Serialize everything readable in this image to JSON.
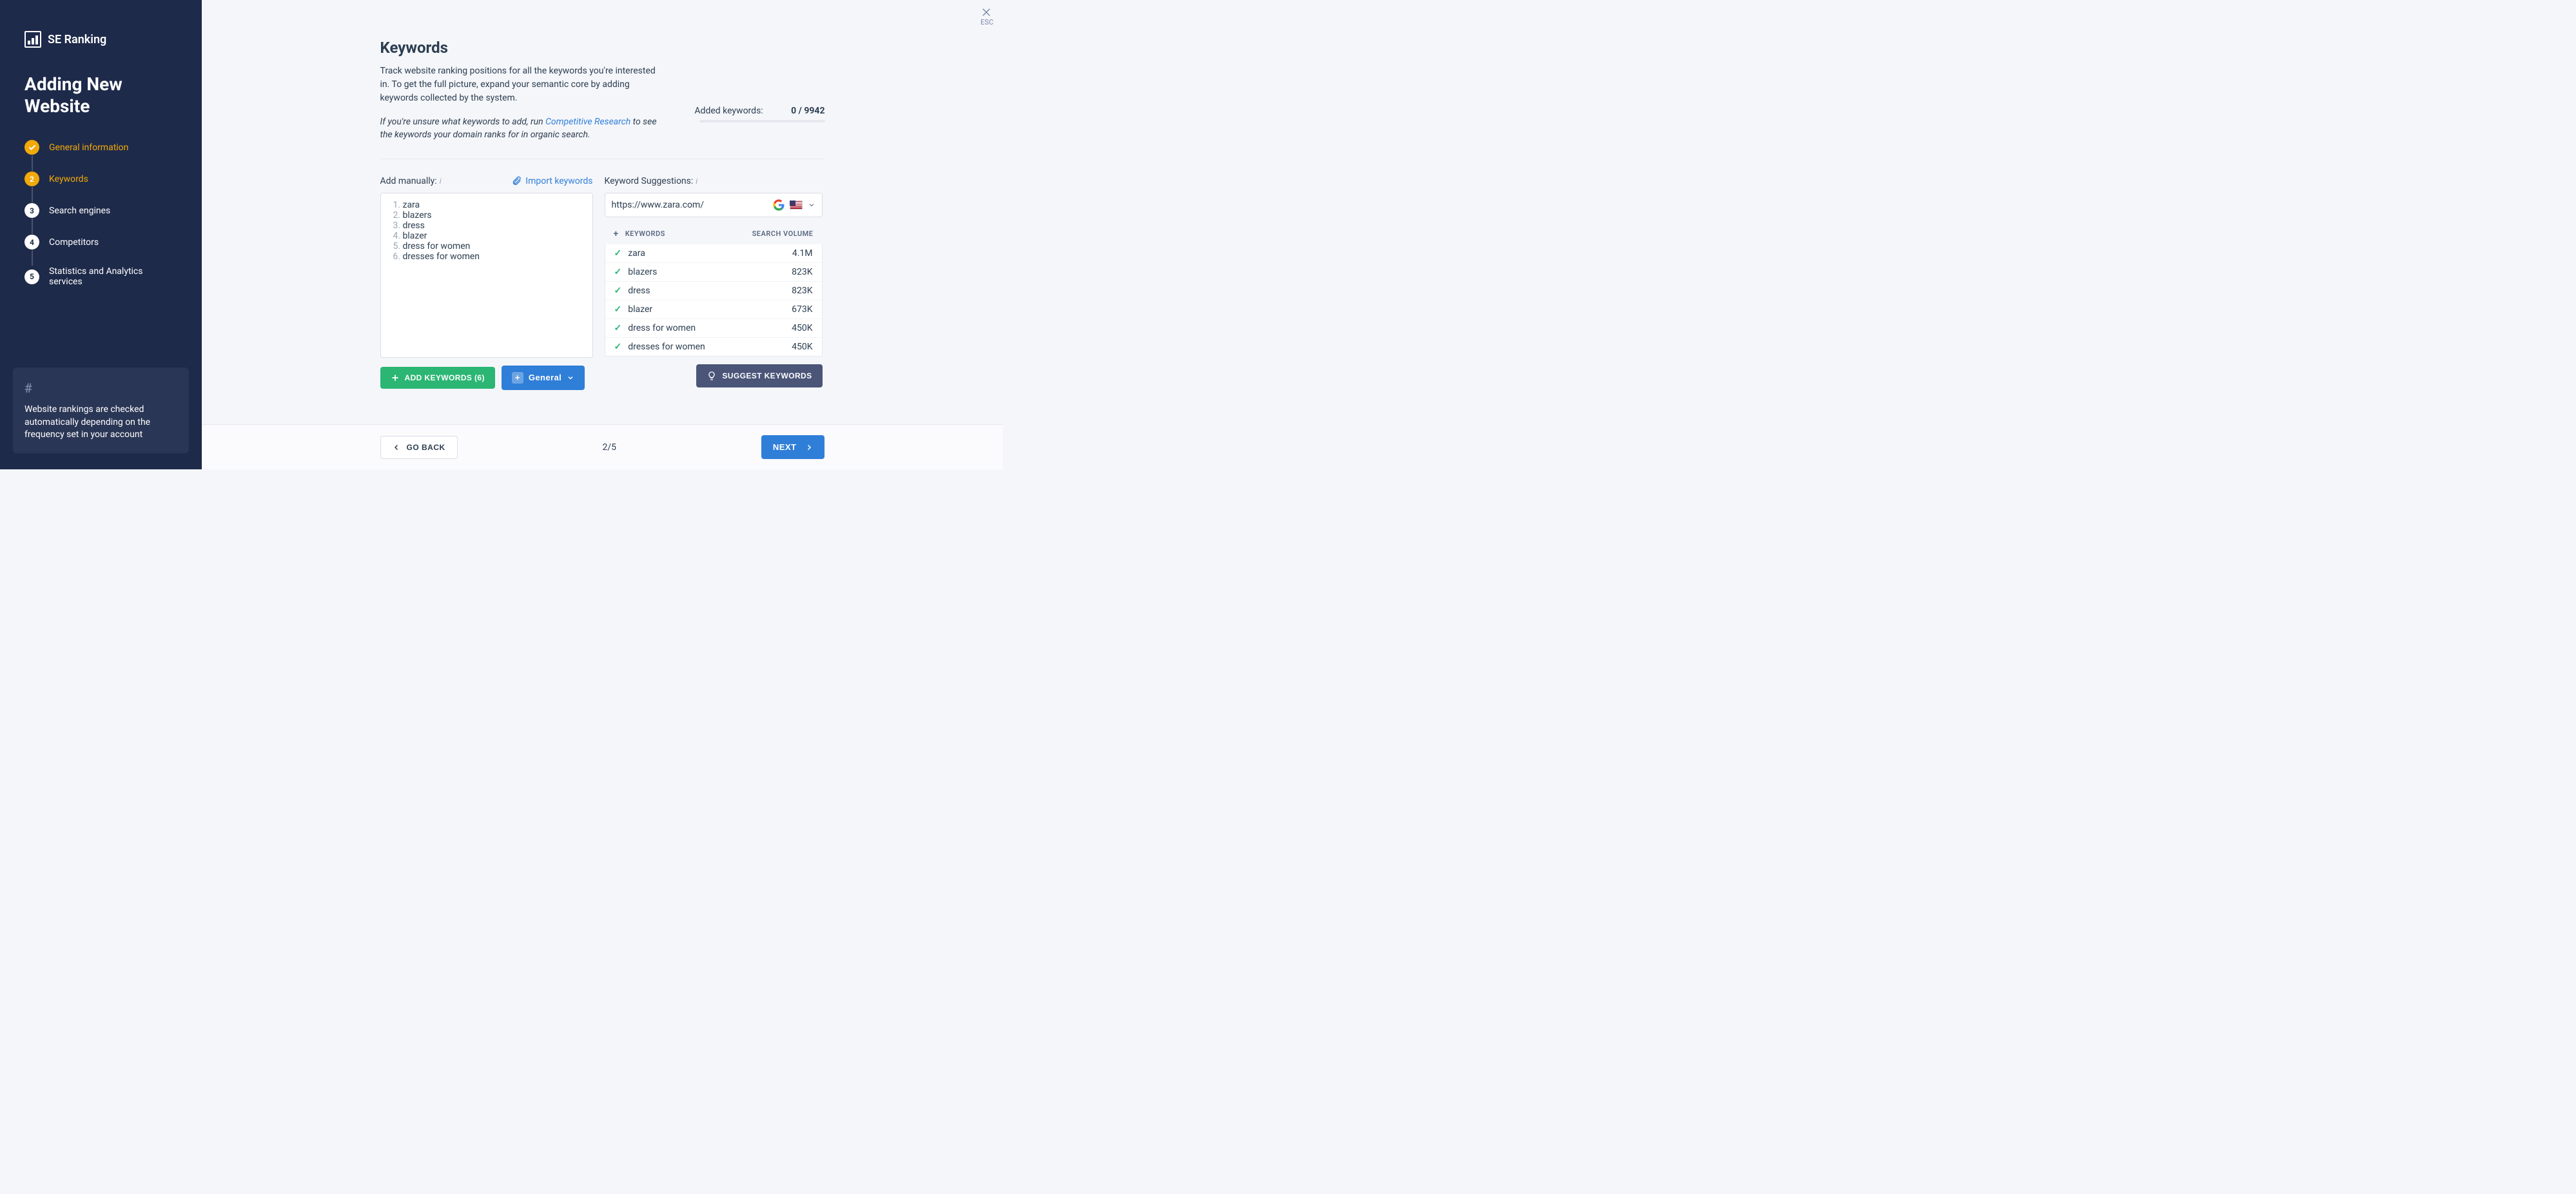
{
  "brand": "SE Ranking",
  "sidebar_title": "Adding New Website",
  "close_label": "ESC",
  "steps": [
    {
      "num_display": "✓",
      "label": "General information"
    },
    {
      "num_display": "2",
      "label": "Keywords"
    },
    {
      "num_display": "3",
      "label": "Search engines"
    },
    {
      "num_display": "4",
      "label": "Competitors"
    },
    {
      "num_display": "5",
      "label": "Statistics and Analytics services"
    }
  ],
  "info_box": "Website rankings are checked automatically depending on the frequency set in your account",
  "page_title": "Keywords",
  "description": "Track website ranking positions for all the keywords you're interested in. To get the full picture, expand your semantic core by adding keywords collected by the system.",
  "hint_pre": "If you're unsure what keywords to add, run ",
  "hint_link": "Competitive Research",
  "hint_post": " to see the keywords your domain ranks for in organic search.",
  "added": {
    "label": "Added keywords:",
    "count": "0 / 9942"
  },
  "manual": {
    "label": "Add manually:",
    "import": "Import keywords",
    "keywords": [
      "zara",
      "blazers",
      "dress",
      "blazer",
      "dress for women",
      "dresses for women"
    ]
  },
  "suggestions": {
    "label": "Keyword Suggestions:",
    "url": "https://www.zara.com/",
    "th_kw": "KEYWORDS",
    "th_vol": "SEARCH VOLUME",
    "items": [
      {
        "kw": "zara",
        "vol": "4.1M"
      },
      {
        "kw": "blazers",
        "vol": "823K"
      },
      {
        "kw": "dress",
        "vol": "823K"
      },
      {
        "kw": "blazer",
        "vol": "673K"
      },
      {
        "kw": "dress for women",
        "vol": "450K"
      },
      {
        "kw": "dresses for women",
        "vol": "450K"
      }
    ]
  },
  "buttons": {
    "add_keywords": "ADD KEYWORDS (6)",
    "group": "General",
    "suggest": "SUGGEST KEYWORDS",
    "go_back": "GO BACK",
    "next": "NEXT"
  },
  "page_indicator": "2/5"
}
